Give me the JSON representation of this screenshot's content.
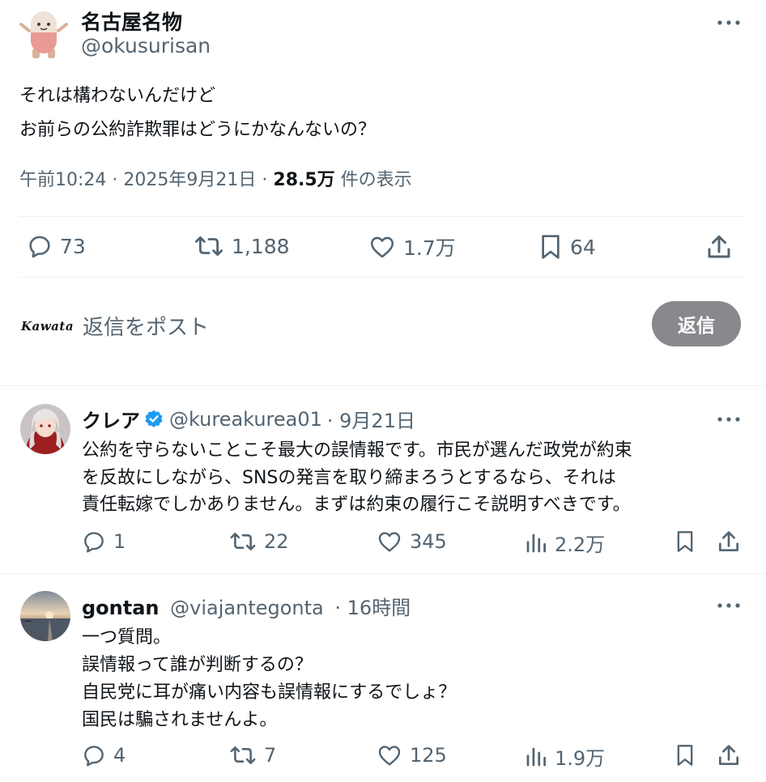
{
  "main_tweet": {
    "display_name": "名古屋名物",
    "handle": "@okusurisan",
    "text_lines": [
      "それは構わないんだけど",
      "お前らの公約詐欺罪はどうにかなんないの？"
    ],
    "time": "午前10:24",
    "sep": "·",
    "date": "2025年9月21日",
    "views": "28.5万",
    "views_label": "件の表示",
    "replies": "73",
    "reposts": "1,188",
    "likes": "1.7万",
    "bookmarks": "64"
  },
  "composer": {
    "logo_text": "Kawata",
    "placeholder": "返信をポスト",
    "reply_button": "返信"
  },
  "replies": [
    {
      "display_name": "クレア",
      "verified": true,
      "handle": "@kureakurea01",
      "time": "· 9月21日",
      "text_lines": [
        "公約を守らないことこそ最大の誤情報です。市民が選んだ政党が約束",
        "を反故にしながら、SNSの発言を取り締まろうとするなら、それは",
        "責任転嫁でしかありません。まずは約束の履行こそ説明すべきです。"
      ],
      "replies": "1",
      "reposts": "22",
      "likes": "345",
      "views": "2.2万"
    },
    {
      "display_name": "gontan",
      "verified": false,
      "handle": "@viajantegonta",
      "time": "· 16時間",
      "text_lines": [
        "一つ質問。",
        "誤情報って誰が判断するの？",
        "自民党に耳が痛い内容も誤情報にするでしょ？",
        "国民は騙されませんよ。"
      ],
      "replies": "4",
      "reposts": "7",
      "likes": "125",
      "views": "1.9万"
    }
  ],
  "colors": {
    "text": "#0f1419",
    "secondary": "#536471",
    "verified": "#1d9bf0",
    "button_disabled": "#87898c",
    "divider": "#eff3f4"
  }
}
